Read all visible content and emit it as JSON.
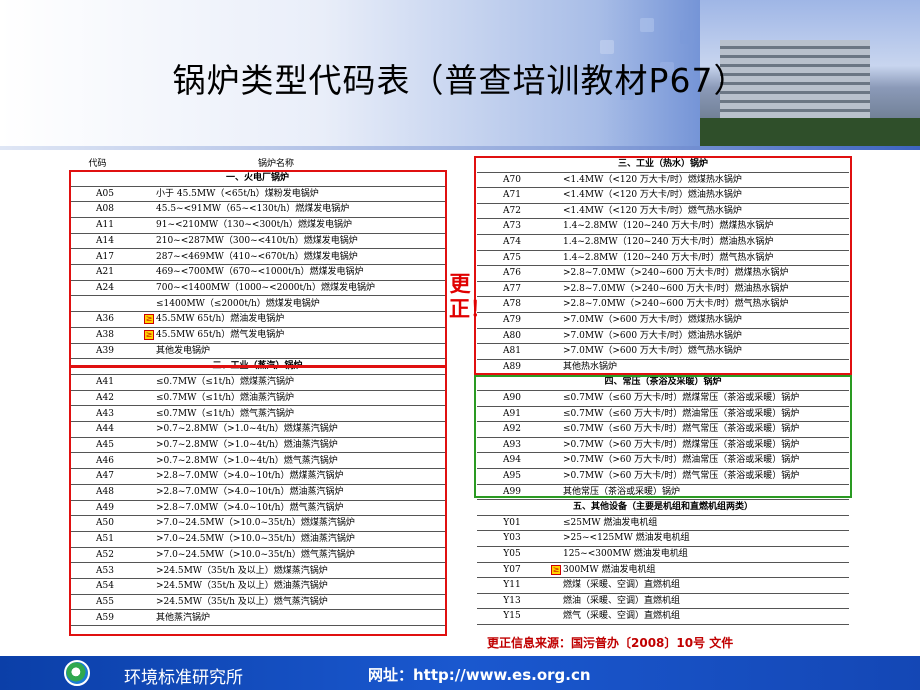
{
  "title": "锅炉类型代码表（普查培训教材P67）",
  "colors": {
    "highlight_red": "#e01010",
    "highlight_green": "#2a9a22",
    "footer_blue": "#1447b5"
  },
  "left_table": {
    "header_code": "代码",
    "header_name": "锅炉名称",
    "rows": [
      {
        "code": "",
        "name": "一、火电厂锅炉",
        "section": true
      },
      {
        "code": "A05",
        "name": "小于 45.5MW（<65t/h）煤粉发电锅炉"
      },
      {
        "code": "A08",
        "name": "45.5~<91MW（65~<130t/h）燃煤发电锅炉"
      },
      {
        "code": "A11",
        "name": "91~<210MW（130~<300t/h）燃煤发电锅炉"
      },
      {
        "code": "A14",
        "name": "210~<287MW（300~<410t/h）燃煤发电锅炉"
      },
      {
        "code": "A17",
        "name": "287~<469MW（410~<670t/h）燃煤发电锅炉"
      },
      {
        "code": "A21",
        "name": "469~<700MW（670~<1000t/h）燃煤发电锅炉"
      },
      {
        "code": "A24",
        "name": "700~<1400MW（1000~<2000t/h）燃煤发电锅炉"
      },
      {
        "code": "",
        "name": "≤1400MW（≤2000t/h）燃煤发电锅炉"
      },
      {
        "code": "A36",
        "name": "45.5MW   65t/h）燃油发电锅炉",
        "mark": true
      },
      {
        "code": "A38",
        "name": "45.5MW   65t/h）燃气发电锅炉",
        "mark": true
      },
      {
        "code": "A39",
        "name": "其他发电锅炉"
      },
      {
        "code": "",
        "name": "二、工业（蒸汽）锅炉",
        "section": true
      },
      {
        "code": "A41",
        "name": "≤0.7MW（≤1t/h）燃煤蒸汽锅炉"
      },
      {
        "code": "A42",
        "name": "≤0.7MW（≤1t/h）燃油蒸汽锅炉"
      },
      {
        "code": "A43",
        "name": "≤0.7MW（≤1t/h）燃气蒸汽锅炉"
      },
      {
        "code": "A44",
        "name": ">0.7~2.8MW（>1.0~4t/h）燃煤蒸汽锅炉"
      },
      {
        "code": "A45",
        "name": ">0.7~2.8MW（>1.0~4t/h）燃油蒸汽锅炉"
      },
      {
        "code": "A46",
        "name": ">0.7~2.8MW（>1.0~4t/h）燃气蒸汽锅炉"
      },
      {
        "code": "A47",
        "name": ">2.8~7.0MW（>4.0~10t/h）燃煤蒸汽锅炉"
      },
      {
        "code": "A48",
        "name": ">2.8~7.0MW（>4.0~10t/h）燃油蒸汽锅炉"
      },
      {
        "code": "A49",
        "name": ">2.8~7.0MW（>4.0~10t/h）燃气蒸汽锅炉"
      },
      {
        "code": "A50",
        "name": ">7.0~24.5MW（>10.0~35t/h）燃煤蒸汽锅炉"
      },
      {
        "code": "A51",
        "name": ">7.0~24.5MW（>10.0~35t/h）燃油蒸汽锅炉"
      },
      {
        "code": "A52",
        "name": ">7.0~24.5MW（>10.0~35t/h）燃气蒸汽锅炉"
      },
      {
        "code": "A53",
        "name": ">24.5MW（35t/h 及以上）燃煤蒸汽锅炉"
      },
      {
        "code": "A54",
        "name": ">24.5MW（35t/h 及以上）燃油蒸汽锅炉"
      },
      {
        "code": "A55",
        "name": ">24.5MW（35t/h 及以上）燃气蒸汽锅炉"
      },
      {
        "code": "A59",
        "name": "其他蒸汽锅炉"
      }
    ]
  },
  "right_table": {
    "rows": [
      {
        "code": "",
        "name": "三、工业（热水）锅炉",
        "section": true
      },
      {
        "code": "A70",
        "name": "<1.4MW（<120 万大卡/时）燃煤热水锅炉"
      },
      {
        "code": "A71",
        "name": "<1.4MW（<120 万大卡/时）燃油热水锅炉"
      },
      {
        "code": "A72",
        "name": "<1.4MW（<120 万大卡/时）燃气热水锅炉"
      },
      {
        "code": "A73",
        "name": "1.4~2.8MW（120~240 万大卡/时）燃煤热水锅炉"
      },
      {
        "code": "A74",
        "name": "1.4~2.8MW（120~240 万大卡/时）燃油热水锅炉"
      },
      {
        "code": "A75",
        "name": "1.4~2.8MW（120~240 万大卡/时）燃气热水锅炉"
      },
      {
        "code": "A76",
        "name": ">2.8~7.0MW（>240~600 万大卡/时）燃煤热水锅炉"
      },
      {
        "code": "A77",
        "name": ">2.8~7.0MW（>240~600 万大卡/时）燃油热水锅炉"
      },
      {
        "code": "A78",
        "name": ">2.8~7.0MW（>240~600 万大卡/时）燃气热水锅炉"
      },
      {
        "code": "A79",
        "name": ">7.0MW（>600 万大卡/时）燃煤热水锅炉"
      },
      {
        "code": "A80",
        "name": ">7.0MW（>600 万大卡/时）燃油热水锅炉"
      },
      {
        "code": "A81",
        "name": ">7.0MW（>600 万大卡/时）燃气热水锅炉"
      },
      {
        "code": "A89",
        "name": "其他热水锅炉"
      },
      {
        "code": "",
        "name": "四、常压（茶浴及采暖）锅炉",
        "section": true
      },
      {
        "code": "A90",
        "name": "≤0.7MW（≤60 万大卡/时）燃煤常压（茶浴或采暖）锅炉"
      },
      {
        "code": "A91",
        "name": "≤0.7MW（≤60 万大卡/时）燃油常压（茶浴或采暖）锅炉"
      },
      {
        "code": "A92",
        "name": "≤0.7MW（≤60 万大卡/时）燃气常压（茶浴或采暖）锅炉"
      },
      {
        "code": "A93",
        "name": ">0.7MW（>60 万大卡/时）燃煤常压（茶浴或采暖）锅炉"
      },
      {
        "code": "A94",
        "name": ">0.7MW（>60 万大卡/时）燃油常压（茶浴或采暖）锅炉"
      },
      {
        "code": "A95",
        "name": ">0.7MW（>60 万大卡/时）燃气常压（茶浴或采暖）锅炉"
      },
      {
        "code": "A99",
        "name": "其他常压（茶浴或采暖）锅炉"
      },
      {
        "code": "",
        "name": "五、其他设备（主要是机组和直燃机组两类）",
        "section": true
      },
      {
        "code": "Y01",
        "name": "≤25MW 燃油发电机组"
      },
      {
        "code": "Y03",
        "name": ">25~<125MW 燃油发电机组"
      },
      {
        "code": "Y05",
        "name": "125~<300MW 燃油发电机组"
      },
      {
        "code": "Y07",
        "name": "300MW 燃油发电机组",
        "mark": true
      },
      {
        "code": "Y11",
        "name": "燃煤（采暖、空调）直燃机组"
      },
      {
        "code": "Y13",
        "name": "燃油（采暖、空调）直燃机组"
      },
      {
        "code": "Y15",
        "name": "燃气（采暖、空调）直燃机组"
      }
    ]
  },
  "correction_label": "更正！",
  "source_note": "更正信息来源：国污普办〔2008〕10号 文件",
  "footer": {
    "org_name": "环境标准研究所",
    "website": "网址：http://www.es.org.cn"
  }
}
